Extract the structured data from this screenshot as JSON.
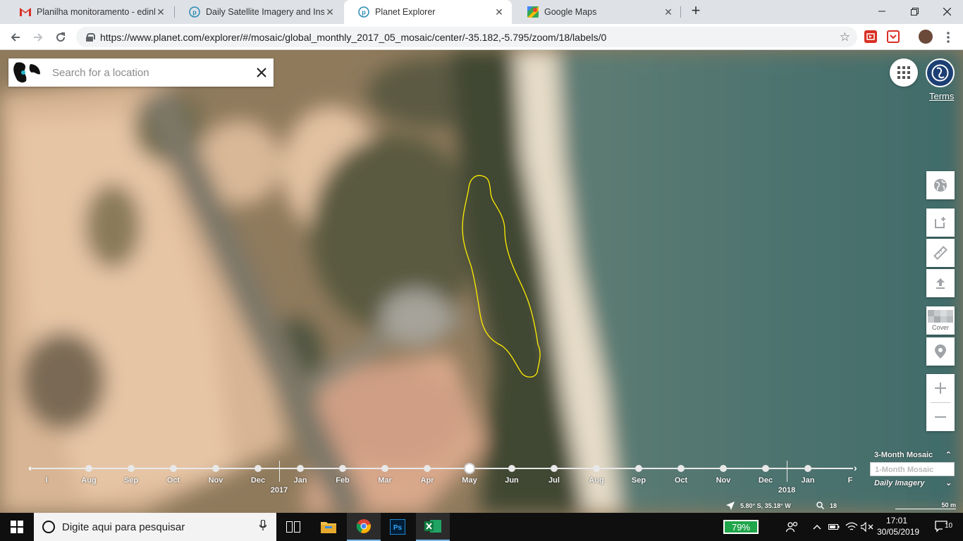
{
  "browser": {
    "tabs": [
      {
        "title": "Planilha monitoramento - edinhc",
        "favicon": "gmail-icon",
        "active": false
      },
      {
        "title": "Daily Satellite Imagery and Insigh",
        "favicon": "planet-icon",
        "active": false
      },
      {
        "title": "Planet Explorer",
        "favicon": "planet-icon",
        "active": true
      },
      {
        "title": "Google Maps",
        "favicon": "google-maps-icon",
        "active": false
      }
    ],
    "url": "https://www.planet.com/explorer/#/mosaic/global_monthly_2017_05_mosaic/center/-35.182,-5.795/zoom/18/labels/0"
  },
  "map": {
    "search_placeholder": "Search for a location",
    "terms_label": "Terms",
    "tools": {
      "cover_label": "Cover"
    },
    "timeline": {
      "months": [
        "l",
        "Aug",
        "Sep",
        "Oct",
        "Nov",
        "Dec",
        "Jan",
        "Feb",
        "Mar",
        "Apr",
        "May",
        "Jun",
        "Jul",
        "Aug",
        "Sep",
        "Oct",
        "Nov",
        "Dec",
        "Jan",
        "F"
      ],
      "selected_month": "May",
      "years": [
        "2017",
        "2018"
      ]
    },
    "mosaic_options": {
      "three_month": "3-Month Mosaic",
      "one_month": "1-Month Mosaic",
      "daily": "Daily Imagery"
    },
    "coordinates": "5.80° S, 35.18° W",
    "zoom_level": "18",
    "scale_label": "50 m",
    "polygon_color": "#ffee00"
  },
  "taskbar": {
    "search_text": "Digite aqui para pesquisar",
    "battery": "79%",
    "time": "17:01",
    "date": "30/05/2019",
    "notification_count": "10"
  }
}
